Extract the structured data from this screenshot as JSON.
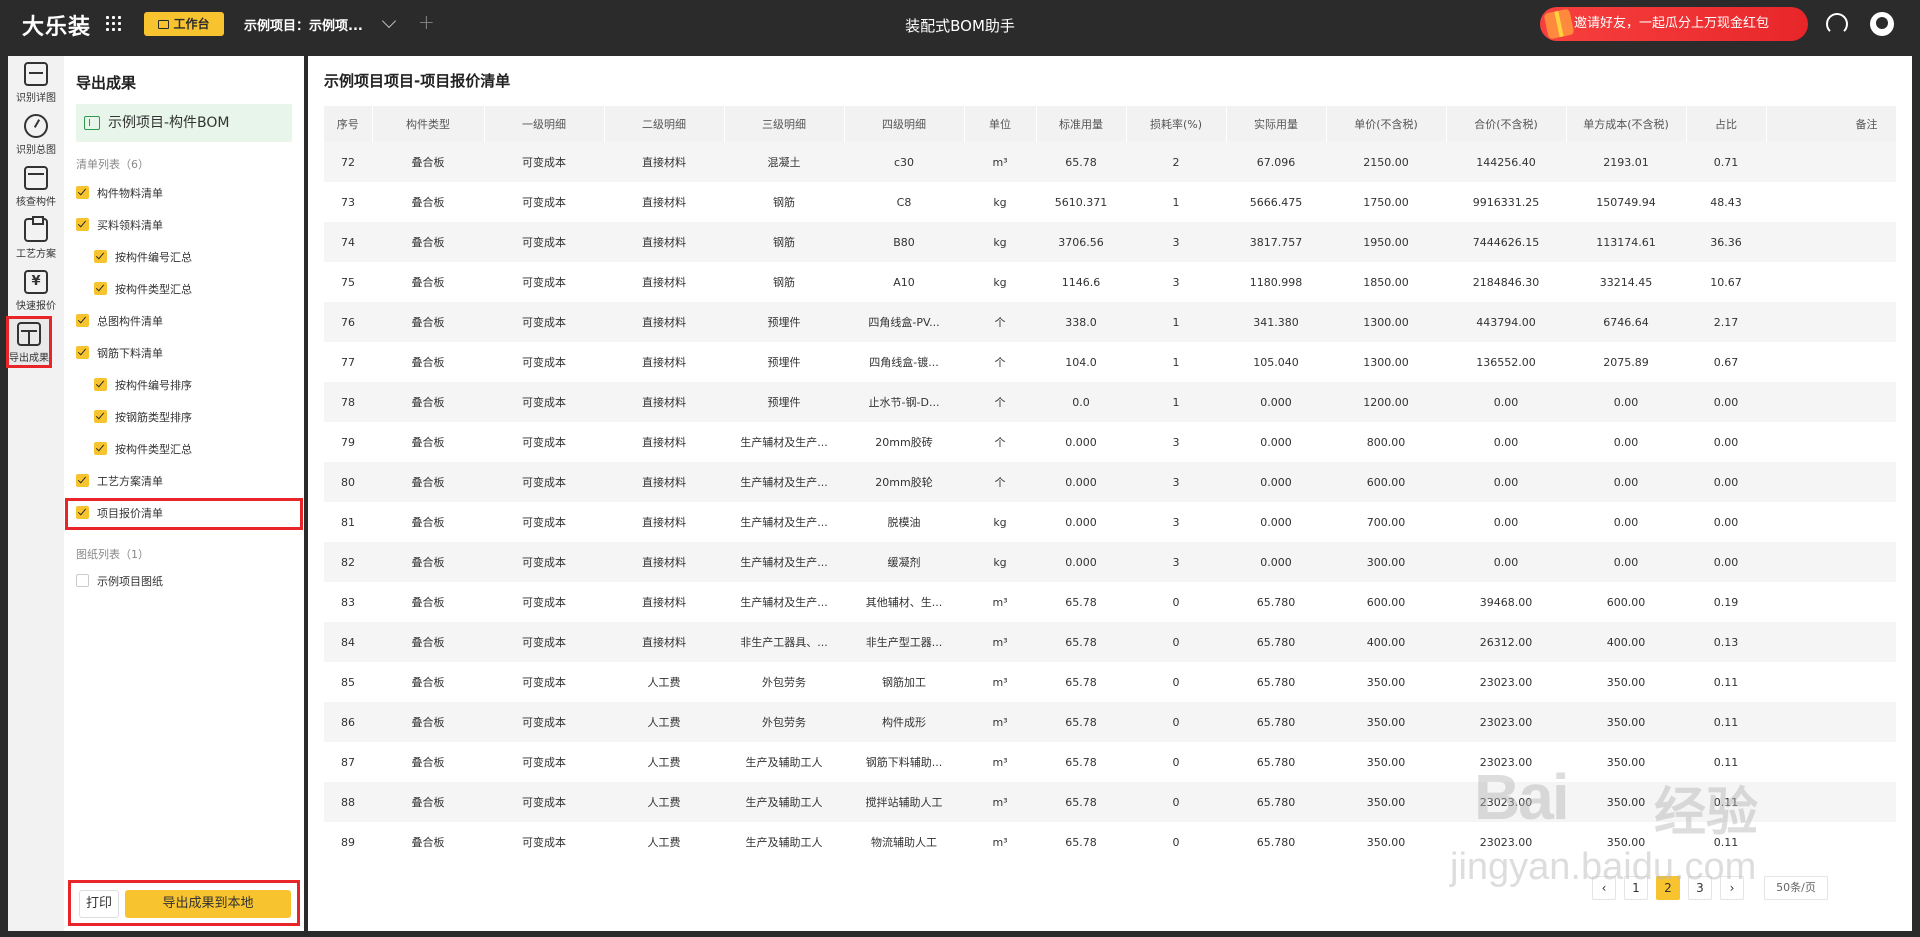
{
  "topbar": {
    "logo": "大乐装",
    "workbench_label": "工作台",
    "project_tab": "示例项目：示例项...",
    "app_title": "装配式BOM助手",
    "invite_text": "邀请好友，一起瓜分上万现金红包"
  },
  "rail": {
    "items": [
      {
        "label": "识别详图",
        "icon": "layers-icon"
      },
      {
        "label": "识别总图",
        "icon": "gauge-icon"
      },
      {
        "label": "核查构件",
        "icon": "calendar-check-icon"
      },
      {
        "label": "工艺方案",
        "icon": "clipboard-icon"
      },
      {
        "label": "快速报价",
        "icon": "yen-icon"
      },
      {
        "label": "导出成果",
        "icon": "table-icon"
      }
    ]
  },
  "panel": {
    "title": "导出成果",
    "bom_file": "示例项目-构件BOM",
    "list_label": "清单列表（6）",
    "items": [
      {
        "label": "构件物料清单",
        "checked": true
      },
      {
        "label": "买料领料清单",
        "checked": true
      },
      {
        "label": "按构件编号汇总",
        "checked": true
      },
      {
        "label": "按构件类型汇总",
        "checked": true
      },
      {
        "label": "总图构件清单",
        "checked": true
      },
      {
        "label": "钢筋下料清单",
        "checked": true
      },
      {
        "label": "按构件编号排序",
        "checked": true
      },
      {
        "label": "按钢筋类型排序",
        "checked": true
      },
      {
        "label": "按构件类型汇总",
        "checked": true
      },
      {
        "label": "工艺方案清单",
        "checked": true
      },
      {
        "label": "项目报价清单",
        "checked": true
      }
    ],
    "drawing_label": "图纸列表（1）",
    "drawing_item": "示例项目图纸",
    "print_label": "打印",
    "export_label": "导出成果到本地"
  },
  "main": {
    "title": "示例项目项目-项目报价清单",
    "headers": [
      "序号",
      "构件类型",
      "一级明细",
      "二级明细",
      "三级明细",
      "四级明细",
      "单位",
      "标准用量",
      "损耗率(%)",
      "实际用量",
      "单价(不含税)",
      "合价(不含税)",
      "单方成本(不含税)",
      "占比",
      "备注"
    ],
    "rows": [
      [
        "72",
        "叠合板",
        "可变成本",
        "直接材料",
        "混凝土",
        "c30",
        "m³",
        "65.78",
        "2",
        "67.096",
        "2150.00",
        "144256.40",
        "2193.01",
        "0.71",
        ""
      ],
      [
        "73",
        "叠合板",
        "可变成本",
        "直接材料",
        "钢筋",
        "C8",
        "kg",
        "5610.371",
        "1",
        "5666.475",
        "1750.00",
        "9916331.25",
        "150749.94",
        "48.43",
        ""
      ],
      [
        "74",
        "叠合板",
        "可变成本",
        "直接材料",
        "钢筋",
        "B80",
        "kg",
        "3706.56",
        "3",
        "3817.757",
        "1950.00",
        "7444626.15",
        "113174.61",
        "36.36",
        ""
      ],
      [
        "75",
        "叠合板",
        "可变成本",
        "直接材料",
        "钢筋",
        "A10",
        "kg",
        "1146.6",
        "3",
        "1180.998",
        "1850.00",
        "2184846.30",
        "33214.45",
        "10.67",
        ""
      ],
      [
        "76",
        "叠合板",
        "可变成本",
        "直接材料",
        "预埋件",
        "四角线盒-PV...",
        "个",
        "338.0",
        "1",
        "341.380",
        "1300.00",
        "443794.00",
        "6746.64",
        "2.17",
        ""
      ],
      [
        "77",
        "叠合板",
        "可变成本",
        "直接材料",
        "预埋件",
        "四角线盒-镀...",
        "个",
        "104.0",
        "1",
        "105.040",
        "1300.00",
        "136552.00",
        "2075.89",
        "0.67",
        ""
      ],
      [
        "78",
        "叠合板",
        "可变成本",
        "直接材料",
        "预埋件",
        "止水节-钢-D...",
        "个",
        "0.0",
        "1",
        "0.000",
        "1200.00",
        "0.00",
        "0.00",
        "0.00",
        ""
      ],
      [
        "79",
        "叠合板",
        "可变成本",
        "直接材料",
        "生产辅材及生产...",
        "20mm胶砖",
        "个",
        "0.000",
        "3",
        "0.000",
        "800.00",
        "0.00",
        "0.00",
        "0.00",
        ""
      ],
      [
        "80",
        "叠合板",
        "可变成本",
        "直接材料",
        "生产辅材及生产...",
        "20mm胶轮",
        "个",
        "0.000",
        "3",
        "0.000",
        "600.00",
        "0.00",
        "0.00",
        "0.00",
        ""
      ],
      [
        "81",
        "叠合板",
        "可变成本",
        "直接材料",
        "生产辅材及生产...",
        "脱模油",
        "kg",
        "0.000",
        "3",
        "0.000",
        "700.00",
        "0.00",
        "0.00",
        "0.00",
        ""
      ],
      [
        "82",
        "叠合板",
        "可变成本",
        "直接材料",
        "生产辅材及生产...",
        "缓凝剂",
        "kg",
        "0.000",
        "3",
        "0.000",
        "300.00",
        "0.00",
        "0.00",
        "0.00",
        ""
      ],
      [
        "83",
        "叠合板",
        "可变成本",
        "直接材料",
        "生产辅材及生产...",
        "其他辅材、生...",
        "m³",
        "65.78",
        "0",
        "65.780",
        "600.00",
        "39468.00",
        "600.00",
        "0.19",
        ""
      ],
      [
        "84",
        "叠合板",
        "可变成本",
        "直接材料",
        "非生产工器具、...",
        "非生产型工器...",
        "m³",
        "65.78",
        "0",
        "65.780",
        "400.00",
        "26312.00",
        "400.00",
        "0.13",
        ""
      ],
      [
        "85",
        "叠合板",
        "可变成本",
        "人工费",
        "外包劳务",
        "钢筋加工",
        "m³",
        "65.78",
        "0",
        "65.780",
        "350.00",
        "23023.00",
        "350.00",
        "0.11",
        ""
      ],
      [
        "86",
        "叠合板",
        "可变成本",
        "人工费",
        "外包劳务",
        "构件成形",
        "m³",
        "65.78",
        "0",
        "65.780",
        "350.00",
        "23023.00",
        "350.00",
        "0.11",
        ""
      ],
      [
        "87",
        "叠合板",
        "可变成本",
        "人工费",
        "生产及辅助工人",
        "钢筋下料辅助...",
        "m³",
        "65.78",
        "0",
        "65.780",
        "350.00",
        "23023.00",
        "350.00",
        "0.11",
        ""
      ],
      [
        "88",
        "叠合板",
        "可变成本",
        "人工费",
        "生产及辅助工人",
        "搅拌站辅助人工",
        "m³",
        "65.78",
        "0",
        "65.780",
        "350.00",
        "23023.00",
        "350.00",
        "0.11",
        ""
      ],
      [
        "89",
        "叠合板",
        "可变成本",
        "人工费",
        "生产及辅助工人",
        "物流辅助人工",
        "m³",
        "65.78",
        "0",
        "65.780",
        "350.00",
        "23023.00",
        "350.00",
        "0.11",
        ""
      ]
    ]
  },
  "pagination": {
    "prev": "‹",
    "pages": [
      "1",
      "2",
      "3"
    ],
    "current": "2",
    "next": "›",
    "page_size": "50条/页"
  },
  "watermark": {
    "line1": "Bai",
    "line2": "经验",
    "line3": "jingyan.baidu.com"
  },
  "colors": {
    "accent": "#f7c32e",
    "highlight": "#e8262a",
    "topbar": "#2b2b2b"
  }
}
